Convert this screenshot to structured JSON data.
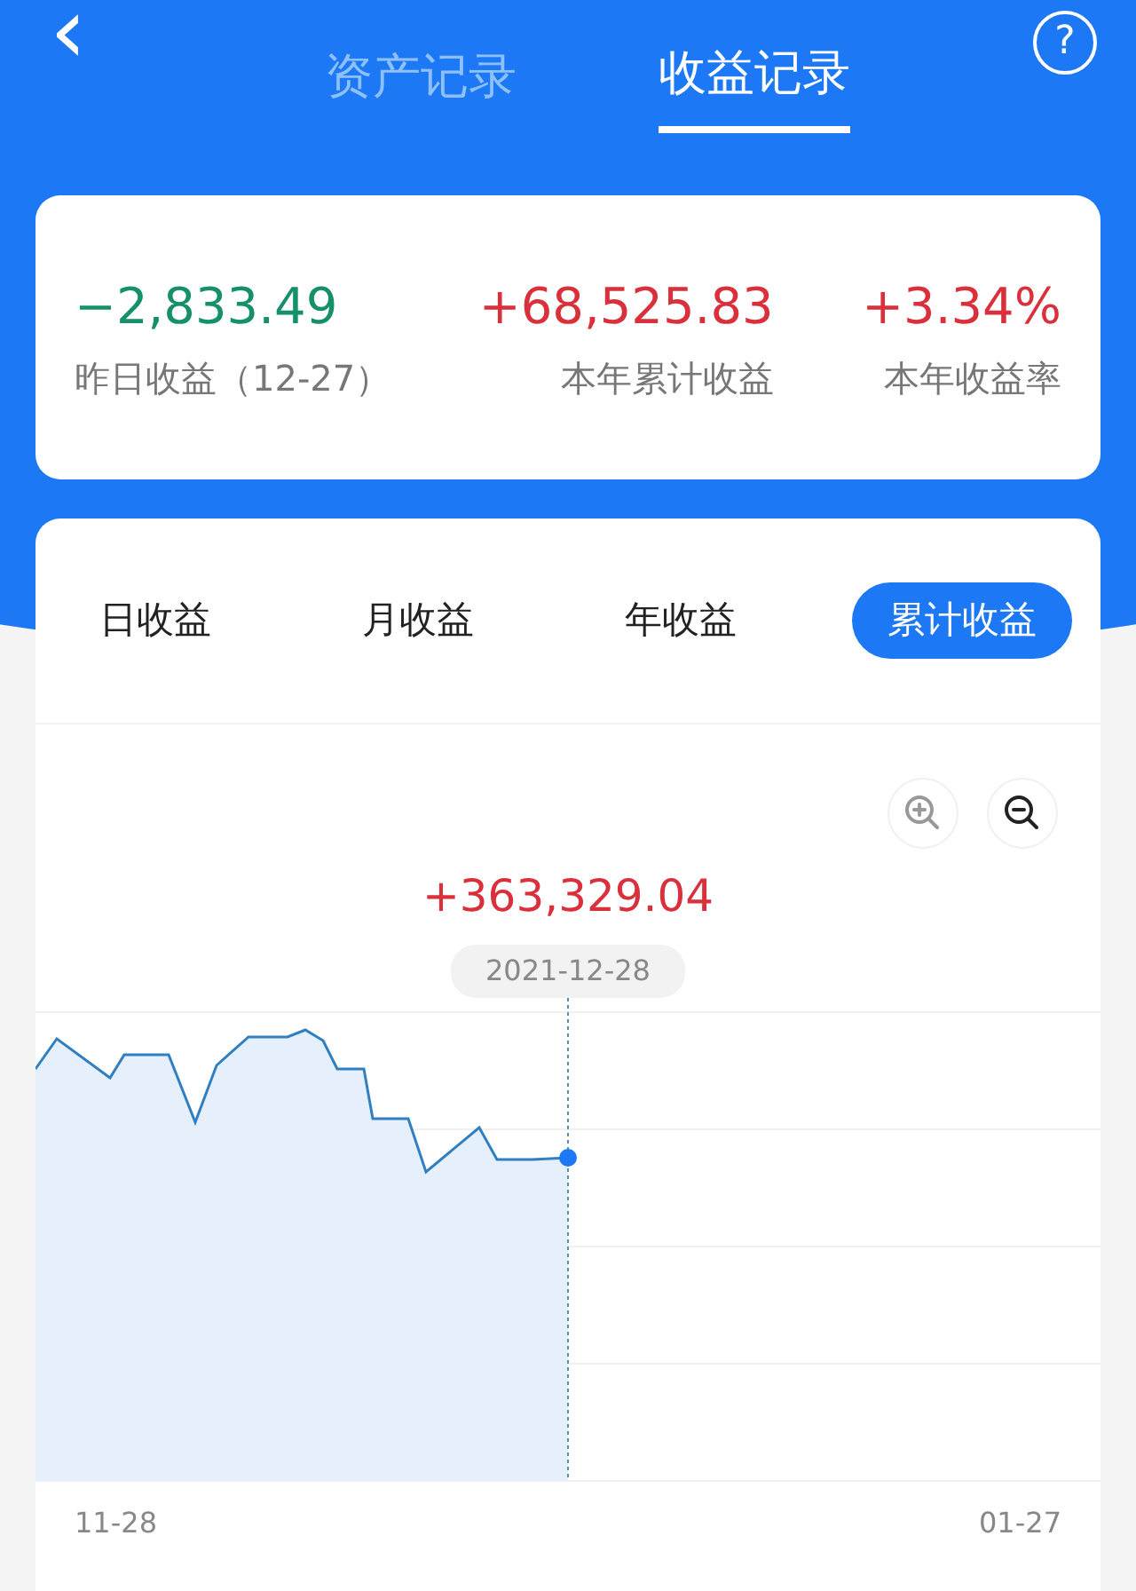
{
  "header": {
    "back": "‹",
    "help": "?"
  },
  "tabs": [
    {
      "label": "资产记录",
      "selected": false
    },
    {
      "label": "收益记录",
      "selected": true
    }
  ],
  "summary": [
    {
      "value": "−2,833.49",
      "label": "昨日收益（12-27）",
      "color": "#15906b"
    },
    {
      "value": "+68,525.83",
      "label": "本年累计收益",
      "color": "#d9303c"
    },
    {
      "value": "+3.34%",
      "label": "本年收益率",
      "color": "#d9303c"
    }
  ],
  "periods": [
    {
      "label": "日收益",
      "selected": false
    },
    {
      "label": "月收益",
      "selected": false
    },
    {
      "label": "年收益",
      "selected": false
    },
    {
      "label": "累计收益",
      "selected": true
    }
  ],
  "zoom": [
    {
      "kind": "in",
      "disabled": true
    },
    {
      "kind": "out",
      "disabled": false
    }
  ],
  "chart": {
    "value": "+363,329.04",
    "date": "2021-12-28",
    "x_start": "11-28",
    "x_end": "01-27"
  }
}
